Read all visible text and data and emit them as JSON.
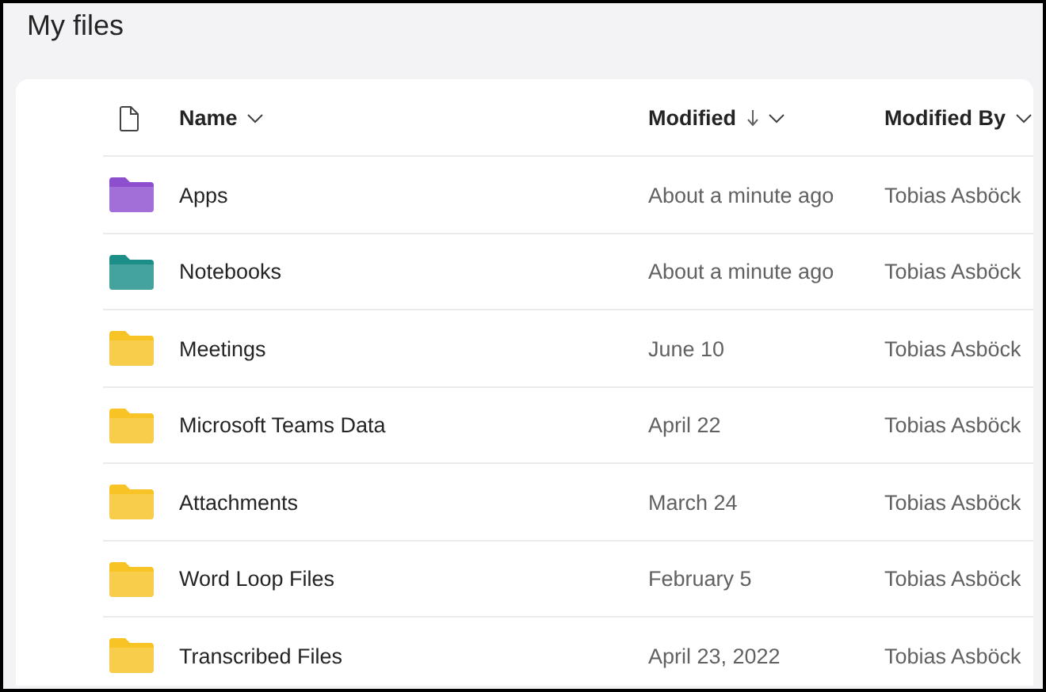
{
  "page": {
    "title": "My files"
  },
  "columns": [
    {
      "label": "Name",
      "sorted": false
    },
    {
      "label": "Modified",
      "sorted": true
    },
    {
      "label": "Modified By",
      "sorted": false
    }
  ],
  "rows": [
    {
      "name": "Apps",
      "modified": "About a minute ago",
      "modified_by": "Tobias Asböck",
      "color": "#8e4fcf"
    },
    {
      "name": "Notebooks",
      "modified": "About a minute ago",
      "modified_by": "Tobias Asböck",
      "color": "#1b8f87"
    },
    {
      "name": "Meetings",
      "modified": "June 10",
      "modified_by": "Tobias Asböck",
      "color": "#f7c325"
    },
    {
      "name": "Microsoft Teams Data",
      "modified": "April 22",
      "modified_by": "Tobias Asböck",
      "color": "#f7c325"
    },
    {
      "name": "Attachments",
      "modified": "March 24",
      "modified_by": "Tobias Asböck",
      "color": "#f7c325"
    },
    {
      "name": "Word Loop Files",
      "modified": "February 5",
      "modified_by": "Tobias Asböck",
      "color": "#f7c325"
    },
    {
      "name": "Transcribed Files",
      "modified": "April 23, 2022",
      "modified_by": "Tobias Asböck",
      "color": "#f7c325"
    }
  ]
}
